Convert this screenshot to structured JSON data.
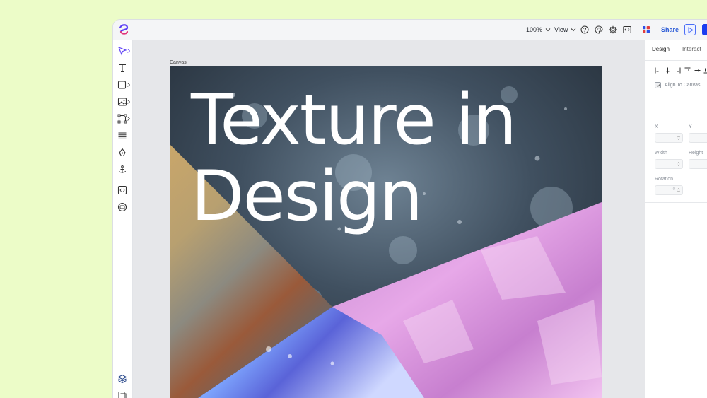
{
  "toolbar": {
    "zoom_label": "100%",
    "view_label": "View",
    "share_label": "Share"
  },
  "canvas": {
    "label": "Canvas",
    "title_line1": "Texture in",
    "title_line2": "Design"
  },
  "panel": {
    "tab_design": "Design",
    "tab_interact": "Interact",
    "align_to_canvas": "Align To Canvas",
    "x_label": "X",
    "y_label": "Y",
    "width_label": "Width",
    "height_label": "Height",
    "rotation_label": "Rotation",
    "rotation_value": "0"
  },
  "colors": {
    "page_background": "#ecfcc8",
    "accent": "#1a3cf0",
    "share_text": "#2b5bd7"
  },
  "icons": {
    "logo": "app-logo-icon",
    "help": "help-icon",
    "palette": "palette-icon",
    "settings": "gear-icon",
    "code": "code-icon",
    "plugins": "grid-icon",
    "play": "play-icon"
  }
}
